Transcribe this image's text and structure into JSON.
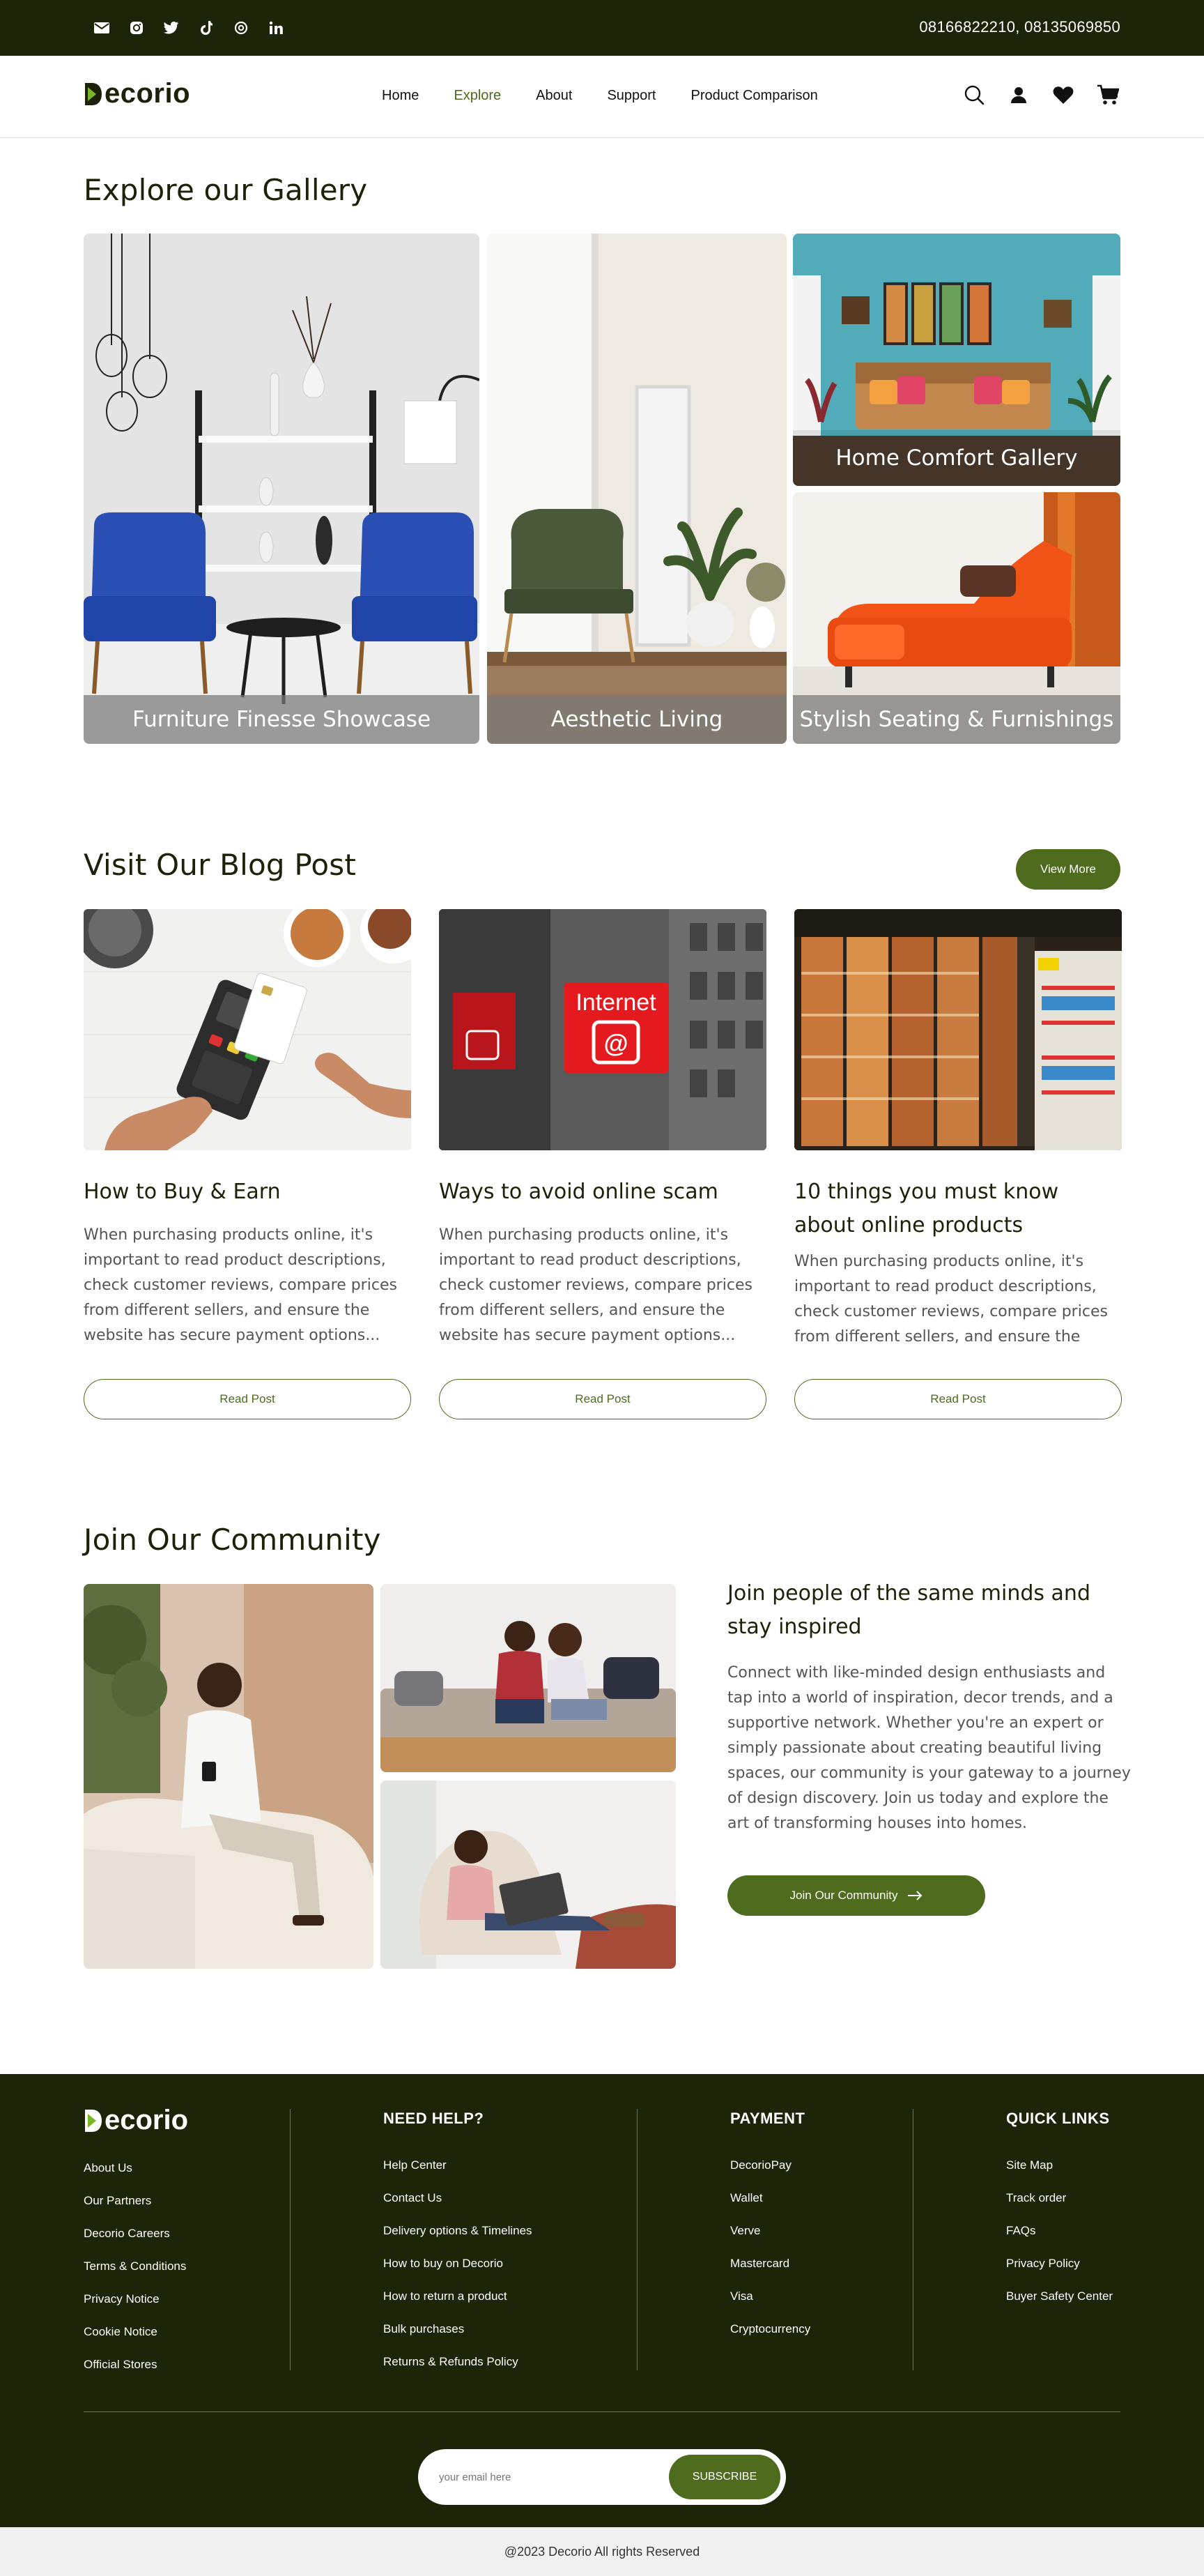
{
  "topbar": {
    "socials": [
      "mail-icon",
      "instagram-icon",
      "twitter-icon",
      "tiktok-icon",
      "threads-icon",
      "linkedin-icon"
    ],
    "phones": "08166822210,  08135069850"
  },
  "header": {
    "brand": "ecorio",
    "brand_initial": "D",
    "nav": [
      {
        "label": "Home",
        "active": false
      },
      {
        "label": "Explore",
        "active": true
      },
      {
        "label": "About",
        "active": false
      },
      {
        "label": "Support",
        "active": false
      },
      {
        "label": "Product Comparison",
        "active": false
      }
    ],
    "icons": [
      "search-icon",
      "user-icon",
      "heart-icon",
      "cart-icon"
    ]
  },
  "gallery": {
    "title": "Explore our Gallery",
    "tiles": [
      {
        "caption": "Furniture Finesse Showcase"
      },
      {
        "caption": "Aesthetic Living"
      },
      {
        "caption": "Home Comfort Gallery"
      },
      {
        "caption": "Stylish Seating & Furnishings"
      }
    ]
  },
  "blog": {
    "title": "Visit Our Blog Post",
    "view_more": "View More",
    "posts": [
      {
        "title": "How to Buy & Earn",
        "text": "When purchasing products online, it's important to read product descriptions, check customer reviews, compare prices from different sellers, and ensure the website has secure payment options...",
        "button": "Read Post"
      },
      {
        "title": "Ways to avoid online scam",
        "text": "When purchasing products online, it's important to read product descriptions, check customer reviews, compare prices from different sellers, and ensure the website has secure payment options...",
        "button": "Read Post",
        "sign": "Internet"
      },
      {
        "title": "10 things you must know about online products",
        "text": "When purchasing products online, it's important to read product descriptions, check customer reviews, compare prices from different sellers, and ensure the",
        "button": "Read Post"
      }
    ]
  },
  "community": {
    "title": "Join Our Community",
    "heading": "Join people of the same minds and stay inspired",
    "text": "Connect with like-minded design enthusiasts and tap into a world of inspiration, decor trends, and a supportive network. Whether you're an expert or simply passionate about creating beautiful living spaces, our community is your gateway to a journey of design discovery. Join us today and explore the art of transforming houses into homes.",
    "button": "Join Our Community"
  },
  "footer": {
    "brand": "ecorio",
    "brand_initial": "D",
    "company_links": [
      "About Us",
      "Our Partners",
      "Decorio Careers",
      "Terms & Conditions",
      "Privacy Notice",
      "Cookie Notice",
      "Official Stores"
    ],
    "help": {
      "heading": "NEED HELP?",
      "links": [
        "Help Center",
        "Contact Us",
        "Delivery options & Timelines",
        "How to buy on Decorio",
        "How to return a product",
        "Bulk purchases",
        "Returns & Refunds Policy"
      ]
    },
    "payment": {
      "heading": "PAYMENT",
      "links": [
        "DecorioPay",
        "Wallet",
        "Verve",
        "Mastercard",
        "Visa",
        "Cryptocurrency"
      ]
    },
    "quick": {
      "heading": "QUICK LINKS",
      "links": [
        "Site Map",
        "Track order",
        "FAQs",
        "Privacy Policy",
        "Buyer Safety Center"
      ]
    },
    "subscribe": {
      "placeholder": "your email here",
      "button": "SUBSCRIBE"
    },
    "copyright": "@2023 Decorio All rights Reserved"
  },
  "colors": {
    "dark": "#1c2508",
    "accent": "#4e6b1e",
    "text": "#555555"
  }
}
